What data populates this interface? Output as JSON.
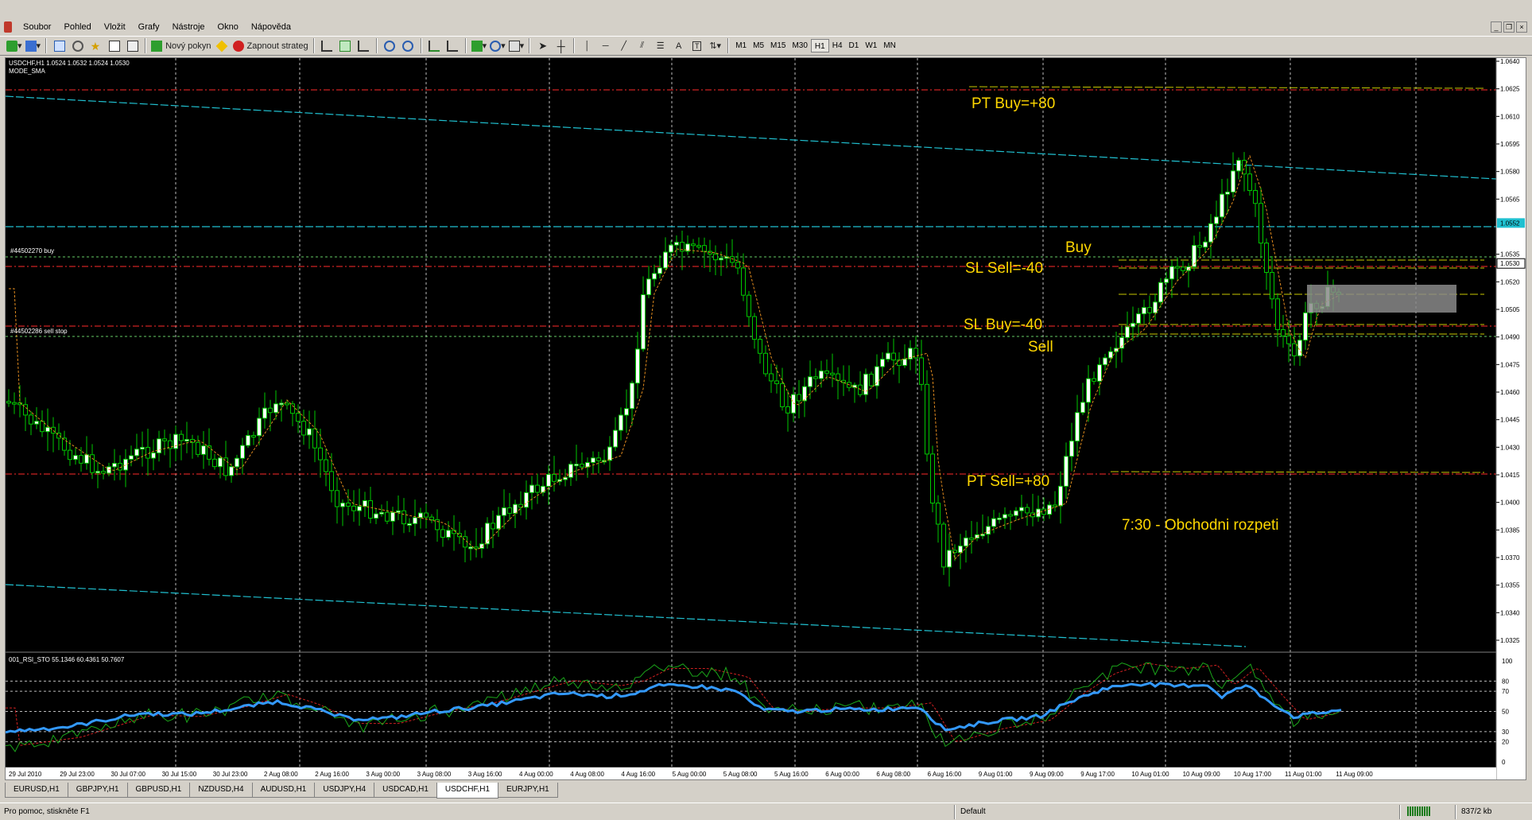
{
  "menu": {
    "items": [
      "Soubor",
      "Pohled",
      "Vložit",
      "Grafy",
      "Nástroje",
      "Okno",
      "Nápověda"
    ]
  },
  "toolbar": {
    "new_order_label": "Nový pokyn",
    "strategy_label": "Zapnout strateg",
    "timeframes": [
      "M1",
      "M5",
      "M15",
      "M30",
      "H1",
      "H4",
      "D1",
      "W1",
      "MN"
    ],
    "active_timeframe": "H1"
  },
  "chart": {
    "header_line1": "USDCHF,H1  1.0524 1.0532 1.0524 1.0530",
    "header_line2": "MODE_SMA",
    "order_buy_label": "#44502270 buy",
    "order_sell_label": "#44502286 sell stop",
    "annotations": {
      "pt_buy": "PT Buy=+80",
      "buy": "Buy",
      "sl_sell": "SL Sell=-40",
      "sl_buy": "SL Buy=-40",
      "sell": "Sell",
      "pt_sell": "PT Sell=+80",
      "range_note": "7:30 - Obchodni rozpeti"
    },
    "price_ticks": [
      "1.0640",
      "1.0625",
      "1.0610",
      "1.0595",
      "1.0580",
      "1.0565",
      "1.0535",
      "1.0520",
      "1.0505",
      "1.0490",
      "1.0475",
      "1.0460",
      "1.0445",
      "1.0430",
      "1.0415",
      "1.0400",
      "1.0385",
      "1.0370",
      "1.0355",
      "1.0340",
      "1.0325"
    ],
    "price_highlight_teal": "1.0552",
    "price_highlight_white": "1.0530",
    "indicator_header": "001_RSI_STO 55.1346 60.4361 50.7607",
    "indicator_ticks": [
      "100",
      "80",
      "70",
      "50",
      "30",
      "20",
      "0"
    ],
    "time_labels": [
      "29 Jul 2010",
      "29 Jul 23:00",
      "30 Jul 07:00",
      "30 Jul 15:00",
      "30 Jul 23:00",
      "2 Aug 08:00",
      "2 Aug 16:00",
      "3 Aug 00:00",
      "3 Aug 08:00",
      "3 Aug 16:00",
      "4 Aug 00:00",
      "4 Aug 08:00",
      "4 Aug 16:00",
      "5 Aug 00:00",
      "5 Aug 08:00",
      "5 Aug 16:00",
      "6 Aug 00:00",
      "6 Aug 08:00",
      "6 Aug 16:00",
      "9 Aug 01:00",
      "9 Aug 09:00",
      "9 Aug 17:00",
      "10 Aug 01:00",
      "10 Aug 09:00",
      "10 Aug 17:00",
      "11 Aug 01:00",
      "11 Aug 09:00"
    ],
    "colors": {
      "bg": "#000000",
      "candle": "#00c800",
      "candle_up_fill": "#ffffff",
      "annotation": "#ffd700",
      "red_level": "#ff2a2a",
      "teal": "#20c0d0",
      "rsi_blue": "#3399ff"
    }
  },
  "tabs": [
    "EURUSD,H1",
    "GBPJPY,H1",
    "GBPUSD,H1",
    "NZDUSD,H4",
    "AUDUSD,H1",
    "USDJPY,H4",
    "USDCAD,H1",
    "USDCHF,H1",
    "EURJPY,H1"
  ],
  "active_tab": "USDCHF,H1",
  "status": {
    "help": "Pro pomoc, stiskněte F1",
    "profile": "Default",
    "traffic": "837/2 kb"
  }
}
